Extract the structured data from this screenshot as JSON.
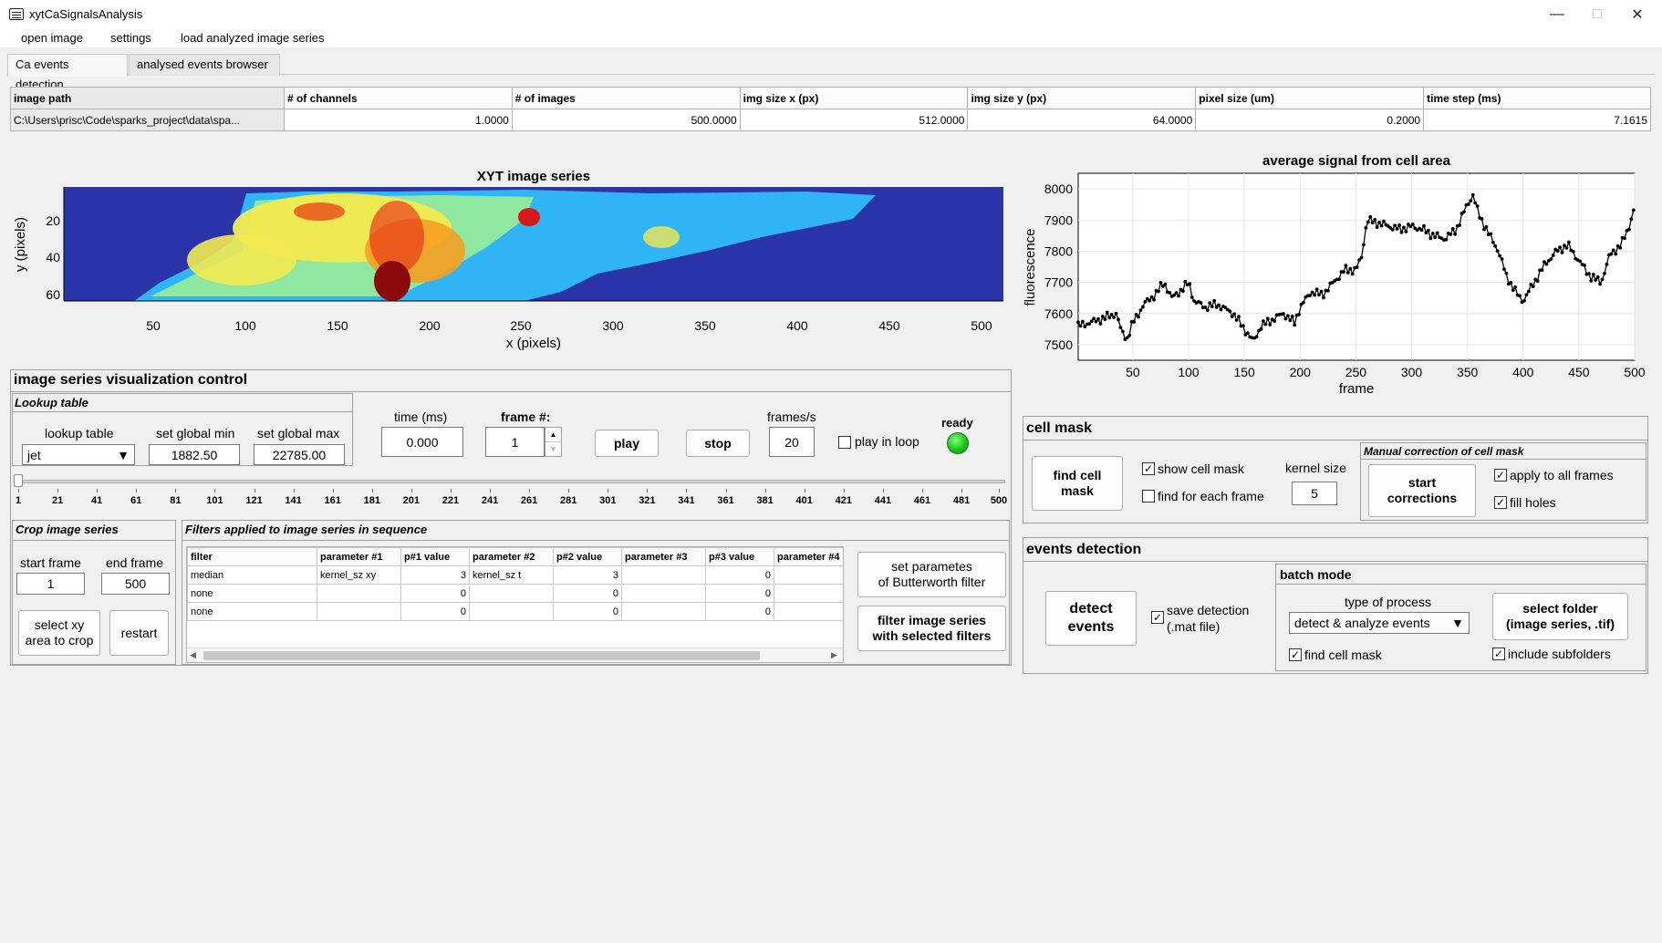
{
  "window": {
    "title": "xytCaSignalsAnalysis"
  },
  "menu": [
    "open image",
    "settings",
    "load analyzed image series"
  ],
  "tabs": [
    "Ca events detection",
    "analysed events browser"
  ],
  "info_table": {
    "headers": [
      "image path",
      "# of channels",
      "# of images",
      "img size x (px)",
      "img size y (px)",
      "pixel size (um)",
      "time step (ms)"
    ],
    "values": [
      "C:\\Users\\prisc\\Code\\sparks_project\\data\\spa...",
      "1.0000",
      "500.0000",
      "512.0000",
      "64.0000",
      "0.2000",
      "7.1615"
    ]
  },
  "image_plot": {
    "title": "XYT image series",
    "xlabel": "x (pixels)",
    "ylabel": "y (pixels)",
    "xticks": [
      "50",
      "100",
      "150",
      "200",
      "250",
      "300",
      "350",
      "400",
      "450",
      "500"
    ],
    "yticks": [
      "20",
      "40",
      "60"
    ]
  },
  "chart_data": {
    "type": "line",
    "title": "average signal from cell area",
    "xlabel": "frame",
    "ylabel": "fluorescence",
    "xlim": [
      1,
      500
    ],
    "ylim": [
      7450,
      8050
    ],
    "xticks": [
      50,
      100,
      150,
      200,
      250,
      300,
      350,
      400,
      450,
      500
    ],
    "yticks": [
      7500,
      7600,
      7700,
      7800,
      7900,
      8000
    ],
    "grid": true,
    "anchors": [
      [
        1,
        7560
      ],
      [
        20,
        7580
      ],
      [
        35,
        7600
      ],
      [
        40,
        7540
      ],
      [
        45,
        7520
      ],
      [
        50,
        7570
      ],
      [
        60,
        7630
      ],
      [
        70,
        7660
      ],
      [
        78,
        7700
      ],
      [
        85,
        7650
      ],
      [
        95,
        7680
      ],
      [
        100,
        7700
      ],
      [
        105,
        7640
      ],
      [
        115,
        7620
      ],
      [
        125,
        7630
      ],
      [
        140,
        7600
      ],
      [
        150,
        7550
      ],
      [
        158,
        7510
      ],
      [
        165,
        7560
      ],
      [
        175,
        7580
      ],
      [
        185,
        7600
      ],
      [
        195,
        7570
      ],
      [
        200,
        7620
      ],
      [
        210,
        7670
      ],
      [
        220,
        7660
      ],
      [
        230,
        7700
      ],
      [
        240,
        7740
      ],
      [
        250,
        7740
      ],
      [
        255,
        7780
      ],
      [
        260,
        7900
      ],
      [
        270,
        7890
      ],
      [
        280,
        7880
      ],
      [
        290,
        7870
      ],
      [
        300,
        7880
      ],
      [
        310,
        7870
      ],
      [
        320,
        7850
      ],
      [
        330,
        7840
      ],
      [
        340,
        7870
      ],
      [
        350,
        7950
      ],
      [
        355,
        7980
      ],
      [
        360,
        7920
      ],
      [
        370,
        7850
      ],
      [
        378,
        7800
      ],
      [
        385,
        7720
      ],
      [
        395,
        7660
      ],
      [
        400,
        7640
      ],
      [
        410,
        7700
      ],
      [
        420,
        7760
      ],
      [
        430,
        7800
      ],
      [
        440,
        7820
      ],
      [
        450,
        7770
      ],
      [
        460,
        7720
      ],
      [
        470,
        7700
      ],
      [
        478,
        7790
      ],
      [
        488,
        7820
      ],
      [
        495,
        7880
      ],
      [
        500,
        7940
      ]
    ]
  },
  "viz_control": {
    "title": "image series visualization control",
    "lut_panel": {
      "title": "Lookup table",
      "lut_label": "lookup table",
      "lut_value": "jet",
      "min_label": "set global min",
      "min_value": "1882.50",
      "max_label": "set global max",
      "max_value": "22785.00"
    },
    "time_label": "time (ms)",
    "time_value": "0.000",
    "frame_label": "frame #:",
    "frame_value": "1",
    "play": "play",
    "stop": "stop",
    "fps_label": "frames/s",
    "fps_value": "20",
    "loop_label": "play in loop",
    "status_label": "ready",
    "slider_ticks": [
      "1",
      "21",
      "41",
      "61",
      "81",
      "101",
      "121",
      "141",
      "161",
      "181",
      "201",
      "221",
      "241",
      "261",
      "281",
      "301",
      "321",
      "341",
      "361",
      "381",
      "401",
      "421",
      "441",
      "461",
      "481",
      "500"
    ]
  },
  "crop": {
    "title": "Crop image series",
    "start_label": "start frame",
    "start_value": "1",
    "end_label": "end frame",
    "end_value": "500",
    "select_btn": "select xy\narea to crop",
    "restart_btn": "restart"
  },
  "filters": {
    "title": "Filters applied to image series in sequence",
    "headers": [
      "filter",
      "parameter #1",
      "p#1 value",
      "parameter #2",
      "p#2 value",
      "parameter #3",
      "p#3 value",
      "parameter #4"
    ],
    "rows": [
      [
        "median",
        "kernel_sz xy",
        "3",
        "kernel_sz t",
        "3",
        "",
        "0",
        ""
      ],
      [
        "none",
        "",
        "0",
        "",
        "0",
        "",
        "0",
        ""
      ],
      [
        "none",
        "",
        "0",
        "",
        "0",
        "",
        "0",
        ""
      ]
    ],
    "butter_btn": "set parametes\nof Butterworth filter",
    "apply_btn": "filter image series\nwith selected filters"
  },
  "cell_mask": {
    "title": "cell mask",
    "find_btn": "find cell\nmask",
    "show_mask": "show cell mask",
    "find_each": "find for each frame",
    "kernel_label": "kernel size",
    "kernel_value": "5",
    "manual_title": "Manual correction of cell mask",
    "start_btn": "start\ncorrections",
    "apply_all": "apply to all frames",
    "fill_holes": "fill holes"
  },
  "events": {
    "title": "events detection",
    "detect_btn": "detect\nevents",
    "save_label": "save detection\n(.mat file)",
    "batch_title": "batch mode",
    "process_label": "type of process",
    "process_value": "detect & analyze events",
    "folder_btn": "select folder\n(image series, .tif)",
    "find_mask": "find cell mask",
    "subfolders": "include subfolders"
  }
}
